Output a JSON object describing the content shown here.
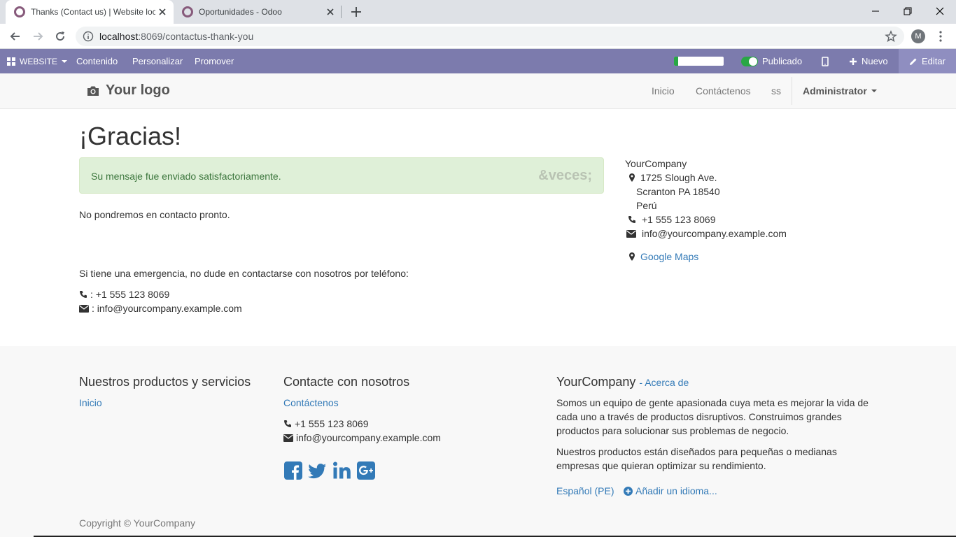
{
  "browser": {
    "tabs": [
      {
        "title": "Thanks (Contact us) | Website loc"
      },
      {
        "title": "Oportunidades - Odoo"
      }
    ],
    "url_host": "localhost",
    "url_rest": ":8069/contactus-thank-you",
    "profile_initial": "M"
  },
  "odoo_bar": {
    "apps_label": "WEBSITE",
    "menu": [
      "Contenido",
      "Personalizar",
      "Promover"
    ],
    "progress": 0.08,
    "published_label": "Publicado",
    "new_label": "Nuevo",
    "edit_label": "Editar",
    "colors": {
      "bar": "#7c7bad",
      "toggle": "#28a745"
    }
  },
  "site_nav": {
    "logo": "Your logo",
    "links": [
      "Inicio",
      "Contáctenos",
      "ss"
    ],
    "user": "Administrator"
  },
  "main": {
    "heading": "¡Gracias!",
    "alert_message": "Su mensaje fue enviado satisfactoriamente.",
    "alert_close": "&veces;",
    "contact_soon": "No pondremos en contacto pronto.",
    "emergency": "Si tiene una emergencia, no dude en contactarse con nosotros por teléfono:",
    "phone_line": ": +1 555 123 8069",
    "email_line": ": info@yourcompany.example.com"
  },
  "company": {
    "name": "YourCompany",
    "street": "1725 Slough Ave.",
    "city": "Scranton PA 18540",
    "country": "Perú",
    "phone": "+1 555 123 8069",
    "email": "info@yourcompany.example.com",
    "maps": "Google Maps"
  },
  "footer": {
    "col1_title": "Nuestros productos y servicios",
    "col1_link": "Inicio",
    "col2_title": "Contacte con nosotros",
    "col2_link": "Contáctenos",
    "col2_phone": "+1 555 123 8069",
    "col2_email": "info@yourcompany.example.com",
    "col3_title": "YourCompany",
    "col3_about": "- Acerca de",
    "col3_p1": "Somos un equipo de gente apasionada cuya meta es mejorar la vida de cada uno a través de productos disruptivos. Construimos grandes productos para solucionar sus problemas de negocio.",
    "col3_p2": "Nuestros productos están diseñados para pequeñas o medianas empresas que quieran optimizar su rendimiento.",
    "lang": "Español (PE)",
    "add_lang": "Añadir un idioma...",
    "copyright": "Copyright © YourCompany",
    "social": [
      "facebook-icon",
      "twitter-icon",
      "linkedin-icon",
      "google-plus-icon"
    ]
  }
}
